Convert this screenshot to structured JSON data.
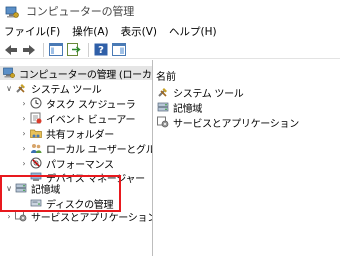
{
  "window": {
    "title": "コンピューターの管理",
    "icon": "computer-management-icon"
  },
  "menubar": {
    "items": [
      "ファイル(F)",
      "操作(A)",
      "表示(V)",
      "ヘルプ(H)"
    ]
  },
  "toolbar": {
    "buttons": [
      "back-arrow-icon",
      "forward-arrow-icon",
      "show-hide-tree-icon",
      "export-list-icon",
      "help-icon",
      "action-pane-icon"
    ]
  },
  "tree": {
    "root": "コンピューターの管理 (ローカル)",
    "system_tools": "システム ツール",
    "task_scheduler": "タスク スケジューラ",
    "event_viewer": "イベント ビューアー",
    "shared_folders": "共有フォルダー",
    "local_users_groups": "ローカル ユーザーとグループ",
    "performance": "パフォーマンス",
    "device_manager": "デバイス マネージャー",
    "storage": "記憶域",
    "disk_management": "ディスクの管理",
    "services_apps": "サービスとアプリケーション"
  },
  "list": {
    "column_name": "名前",
    "items": [
      "システム ツール",
      "記憶域",
      "サービスとアプリケーション"
    ]
  },
  "colors": {
    "highlight_border": "#e8191e",
    "selected_row": "#e5e5e5"
  }
}
